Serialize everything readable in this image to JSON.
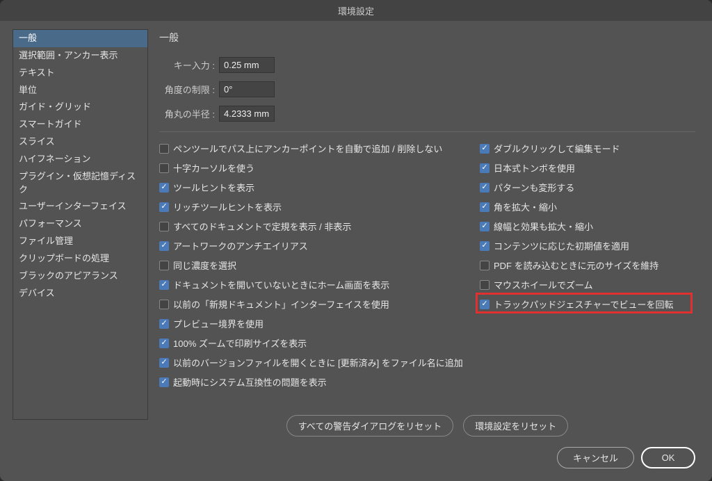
{
  "title": "環境設定",
  "sidebar": {
    "items": [
      "一般",
      "選択範囲・アンカー表示",
      "テキスト",
      "単位",
      "ガイド・グリッド",
      "スマートガイド",
      "スライス",
      "ハイフネーション",
      "プラグイン・仮想記憶ディスク",
      "ユーザーインターフェイス",
      "パフォーマンス",
      "ファイル管理",
      "クリップボードの処理",
      "ブラックのアピアランス",
      "デバイス"
    ],
    "selected_index": 0
  },
  "panel": {
    "title": "一般",
    "fields": {
      "key_input_label": "キー入力 :",
      "key_input_value": "0.25 mm",
      "angle_label": "角度の制限 :",
      "angle_value": "0°",
      "radius_label": "角丸の半径 :",
      "radius_value": "4.2333 mm"
    },
    "left_checks": [
      {
        "label": "ペンツールでパス上にアンカーポイントを自動で追加 / 削除しない",
        "checked": false
      },
      {
        "label": "十字カーソルを使う",
        "checked": false
      },
      {
        "label": "ツールヒントを表示",
        "checked": true
      },
      {
        "label": "リッチツールヒントを表示",
        "checked": true
      },
      {
        "label": "すべてのドキュメントで定規を表示 / 非表示",
        "checked": false
      },
      {
        "label": "アートワークのアンチエイリアス",
        "checked": true
      },
      {
        "label": "同じ濃度を選択",
        "checked": false
      },
      {
        "label": "ドキュメントを開いていないときにホーム画面を表示",
        "checked": true
      },
      {
        "label": "以前の「新規ドキュメント」インターフェイスを使用",
        "checked": false
      },
      {
        "label": "プレビュー境界を使用",
        "checked": true
      },
      {
        "label": "100% ズームで印刷サイズを表示",
        "checked": true
      },
      {
        "label": "以前のバージョンファイルを開くときに [更新済み] をファイル名に追加",
        "checked": true
      },
      {
        "label": "起動時にシステム互換性の問題を表示",
        "checked": true
      }
    ],
    "right_checks": [
      {
        "label": "ダブルクリックして編集モード",
        "checked": true
      },
      {
        "label": "日本式トンボを使用",
        "checked": true
      },
      {
        "label": "パターンも変形する",
        "checked": true
      },
      {
        "label": "角を拡大・縮小",
        "checked": true
      },
      {
        "label": "線幅と効果も拡大・縮小",
        "checked": true
      },
      {
        "label": "コンテンツに応じた初期値を適用",
        "checked": true
      },
      {
        "label": "PDF を読み込むときに元のサイズを維持",
        "checked": false
      },
      {
        "label": "マウスホイールでズーム",
        "checked": false
      },
      {
        "label": "トラックパッドジェスチャーでビューを回転",
        "checked": true,
        "highlight": true
      }
    ],
    "reset_dialogs": "すべての警告ダイアログをリセット",
    "reset_prefs": "環境設定をリセット"
  },
  "footer": {
    "cancel": "キャンセル",
    "ok": "OK"
  }
}
